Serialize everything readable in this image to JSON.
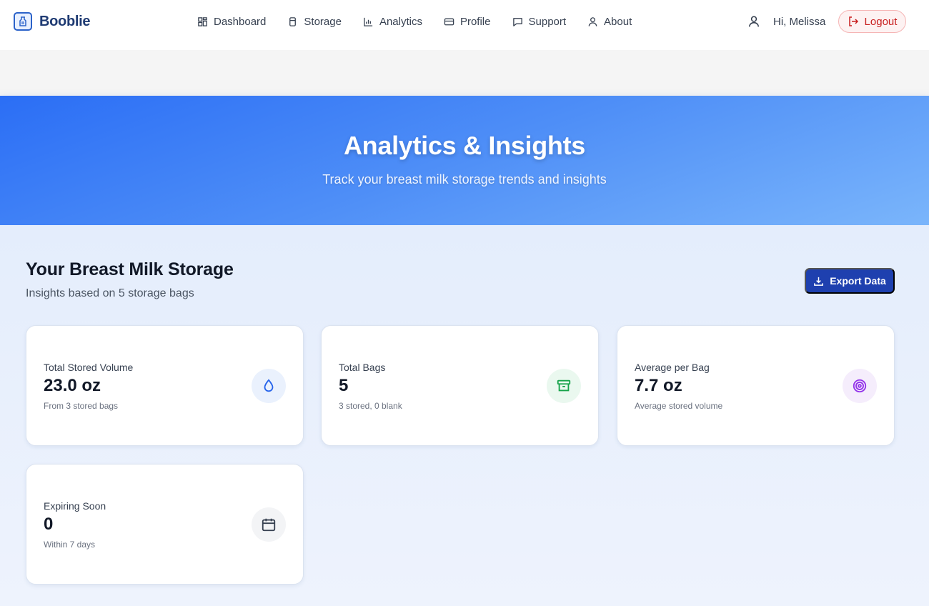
{
  "brand": {
    "name": "Booblie"
  },
  "nav": {
    "items": [
      {
        "label": "Dashboard",
        "icon": "dashboard-icon"
      },
      {
        "label": "Storage",
        "icon": "storage-icon"
      },
      {
        "label": "Analytics",
        "icon": "analytics-icon"
      },
      {
        "label": "Profile",
        "icon": "profile-icon"
      },
      {
        "label": "Support",
        "icon": "support-icon"
      },
      {
        "label": "About",
        "icon": "about-icon"
      }
    ]
  },
  "user": {
    "greeting": "Hi, Melissa",
    "logout_label": "Logout"
  },
  "hero": {
    "title": "Analytics & Insights",
    "subtitle": "Track your breast milk storage trends and insights"
  },
  "section": {
    "title": "Your Breast Milk Storage",
    "subtitle": "Insights based on 5 storage bags",
    "export_label": "Export Data"
  },
  "cards": [
    {
      "label": "Total Stored Volume",
      "value": "23.0 oz",
      "note": "From 3 stored bags",
      "icon": "droplet-icon",
      "color": "#2563eb",
      "bg": "#eaf1fd"
    },
    {
      "label": "Total Bags",
      "value": "5",
      "note": "3 stored, 0 blank",
      "icon": "archive-box-icon",
      "color": "#16a34a",
      "bg": "#eaf8ef"
    },
    {
      "label": "Average per Bag",
      "value": "7.7 oz",
      "note": "Average stored volume",
      "icon": "target-icon",
      "color": "#9333ea",
      "bg": "#f5edfc"
    },
    {
      "label": "Expiring Soon",
      "value": "0",
      "note": "Within 7 days",
      "icon": "calendar-icon",
      "color": "#374151",
      "bg": "#f3f4f6"
    }
  ],
  "colors": {
    "accent": "#1e40af",
    "hero_start": "#2b6ef5",
    "hero_end": "#7ab5fb",
    "logout": "#c81e1e"
  }
}
